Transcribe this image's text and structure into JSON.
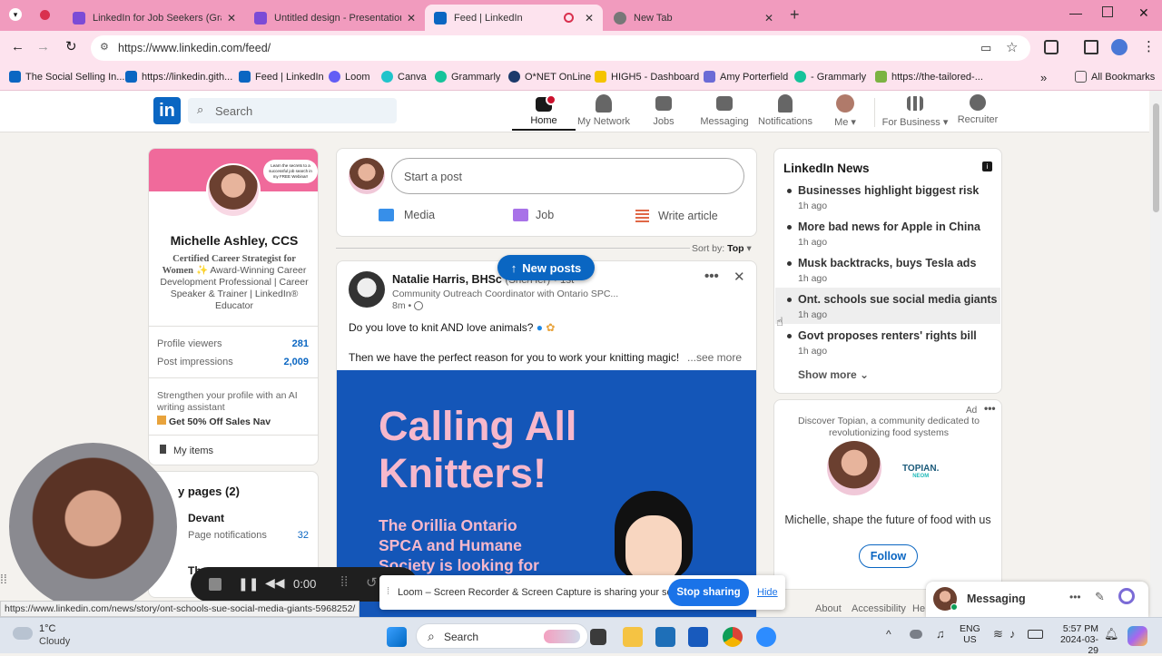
{
  "tabs": [
    {
      "label": "LinkedIn for Job Seekers (Graph",
      "color": "#7b4bd6"
    },
    {
      "label": "Untitled design - Presentation",
      "color": "#7b4bd6"
    },
    {
      "label": "Feed | LinkedIn",
      "color": "#0a66c2"
    },
    {
      "label": "New Tab",
      "color": "#777"
    }
  ],
  "url": "https://www.linkedin.com/feed/",
  "bookmarks": [
    "The Social Selling In...",
    "https://linkedin.gith...",
    "Feed | LinkedIn",
    "Loom",
    "Canva",
    "Grammarly",
    "O*NET OnLine",
    "HIGH5 - Dashboard",
    "Amy Porterfield",
    "- Grammarly",
    "https://the-tailored-...",
    "All Bookmarks"
  ],
  "header": {
    "search_placeholder": "Search",
    "nav": [
      "Home",
      "My Network",
      "Jobs",
      "Messaging",
      "Notifications",
      "Me",
      "For Business",
      "Recruiter"
    ]
  },
  "profile": {
    "name": "Michelle Ashley, CCS",
    "headline_bold": "Certified Career Strategist for Women",
    "headline_rest": "✨ Award-Winning Career Development Professional | Career Speaker & Trainer | LinkedIn® Educator",
    "banner_text": "Learn the secrets to a successful job search in my FREE Webinar!",
    "stats": [
      {
        "label": "Profile viewers",
        "value": "281"
      },
      {
        "label": "Post impressions",
        "value": "2,009"
      }
    ],
    "promo": "Strengthen your profile with an AI writing assistant",
    "promo_link": "Get 50% Off Sales Nav",
    "my_items": "My items",
    "pages_title": "y pages (2)",
    "page1": "Devant",
    "page1_sub": "Page notifications",
    "page1_count": "32",
    "page2": "Th"
  },
  "composer": {
    "placeholder": "Start a post",
    "media": "Media",
    "job": "Job",
    "article": "Write article"
  },
  "sort": {
    "label": "Sort by:",
    "value": "Top"
  },
  "new_posts": "New posts",
  "post": {
    "author": "Natalie Harris, BHSc",
    "pronoun": "(She/Her)",
    "degree": "• 1st",
    "title": "Community Outreach Coordinator with Ontario SPC...",
    "time": "8m •",
    "line1": "Do you love to knit AND love animals?",
    "line2": "Then we have the perfect reason for you to work your knitting magic!",
    "see_more": "...see more",
    "img_title1": "Calling All",
    "img_title2": "Knitters!",
    "img_sub1": "The Orillia Ontario",
    "img_sub2": "SPCA and Humane",
    "img_sub3": "Society is looking for"
  },
  "news": {
    "title": "LinkedIn News",
    "items": [
      {
        "t": "Businesses highlight biggest risk",
        "a": "1h ago"
      },
      {
        "t": "More bad news for Apple in China",
        "a": "1h ago"
      },
      {
        "t": "Musk backtracks, buys Tesla ads",
        "a": "1h ago"
      },
      {
        "t": "Ont. schools sue social media giants",
        "a": "1h ago"
      },
      {
        "t": "Govt proposes renters' rights bill",
        "a": "1h ago"
      }
    ],
    "show_more": "Show more"
  },
  "ad": {
    "badge": "Ad",
    "text": "Discover Topian, a community dedicated to revolutionizing food systems",
    "brand": "TOPIAN.",
    "brand_sub": "NEOM",
    "cta_text": "Michelle, shape the future of food with us",
    "follow": "Follow"
  },
  "footer": {
    "about": "About",
    "access": "Accessibility",
    "he": "He"
  },
  "messaging": "Messaging",
  "loom": {
    "time": "0:00",
    "msg": "Loom – Screen Recorder & Screen Capture is sharing your screen.",
    "stop": "Stop sharing",
    "hide": "Hide"
  },
  "status_url": "https://www.linkedin.com/news/story/ont-schools-sue-social-media-giants-5968252/",
  "taskbar": {
    "temp": "1°C",
    "weather": "Cloudy",
    "search": "Search",
    "lang1": "ENG",
    "lang2": "US",
    "time": "5:57 PM",
    "date": "2024-03-29"
  }
}
